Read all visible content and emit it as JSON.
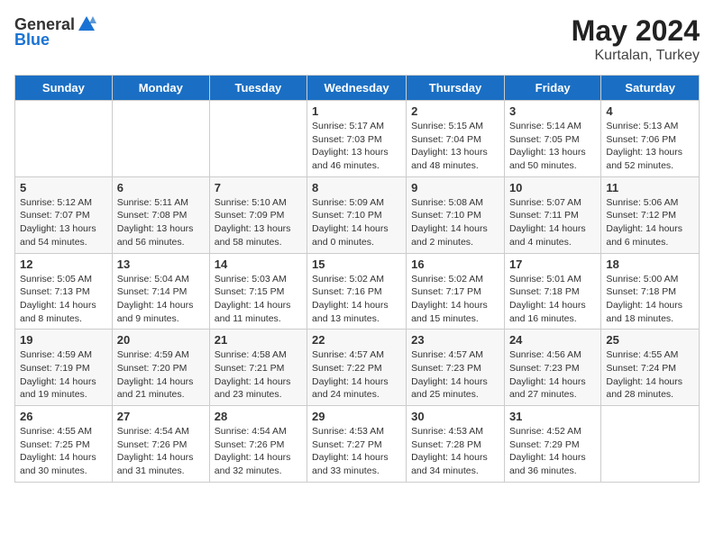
{
  "header": {
    "logo_general": "General",
    "logo_blue": "Blue",
    "month_year": "May 2024",
    "location": "Kurtalan, Turkey"
  },
  "days_of_week": [
    "Sunday",
    "Monday",
    "Tuesday",
    "Wednesday",
    "Thursday",
    "Friday",
    "Saturday"
  ],
  "weeks": [
    [
      {
        "day": "",
        "info": ""
      },
      {
        "day": "",
        "info": ""
      },
      {
        "day": "",
        "info": ""
      },
      {
        "day": "1",
        "info": "Sunrise: 5:17 AM\nSunset: 7:03 PM\nDaylight: 13 hours\nand 46 minutes."
      },
      {
        "day": "2",
        "info": "Sunrise: 5:15 AM\nSunset: 7:04 PM\nDaylight: 13 hours\nand 48 minutes."
      },
      {
        "day": "3",
        "info": "Sunrise: 5:14 AM\nSunset: 7:05 PM\nDaylight: 13 hours\nand 50 minutes."
      },
      {
        "day": "4",
        "info": "Sunrise: 5:13 AM\nSunset: 7:06 PM\nDaylight: 13 hours\nand 52 minutes."
      }
    ],
    [
      {
        "day": "5",
        "info": "Sunrise: 5:12 AM\nSunset: 7:07 PM\nDaylight: 13 hours\nand 54 minutes."
      },
      {
        "day": "6",
        "info": "Sunrise: 5:11 AM\nSunset: 7:08 PM\nDaylight: 13 hours\nand 56 minutes."
      },
      {
        "day": "7",
        "info": "Sunrise: 5:10 AM\nSunset: 7:09 PM\nDaylight: 13 hours\nand 58 minutes."
      },
      {
        "day": "8",
        "info": "Sunrise: 5:09 AM\nSunset: 7:10 PM\nDaylight: 14 hours\nand 0 minutes."
      },
      {
        "day": "9",
        "info": "Sunrise: 5:08 AM\nSunset: 7:10 PM\nDaylight: 14 hours\nand 2 minutes."
      },
      {
        "day": "10",
        "info": "Sunrise: 5:07 AM\nSunset: 7:11 PM\nDaylight: 14 hours\nand 4 minutes."
      },
      {
        "day": "11",
        "info": "Sunrise: 5:06 AM\nSunset: 7:12 PM\nDaylight: 14 hours\nand 6 minutes."
      }
    ],
    [
      {
        "day": "12",
        "info": "Sunrise: 5:05 AM\nSunset: 7:13 PM\nDaylight: 14 hours\nand 8 minutes."
      },
      {
        "day": "13",
        "info": "Sunrise: 5:04 AM\nSunset: 7:14 PM\nDaylight: 14 hours\nand 9 minutes."
      },
      {
        "day": "14",
        "info": "Sunrise: 5:03 AM\nSunset: 7:15 PM\nDaylight: 14 hours\nand 11 minutes."
      },
      {
        "day": "15",
        "info": "Sunrise: 5:02 AM\nSunset: 7:16 PM\nDaylight: 14 hours\nand 13 minutes."
      },
      {
        "day": "16",
        "info": "Sunrise: 5:02 AM\nSunset: 7:17 PM\nDaylight: 14 hours\nand 15 minutes."
      },
      {
        "day": "17",
        "info": "Sunrise: 5:01 AM\nSunset: 7:18 PM\nDaylight: 14 hours\nand 16 minutes."
      },
      {
        "day": "18",
        "info": "Sunrise: 5:00 AM\nSunset: 7:18 PM\nDaylight: 14 hours\nand 18 minutes."
      }
    ],
    [
      {
        "day": "19",
        "info": "Sunrise: 4:59 AM\nSunset: 7:19 PM\nDaylight: 14 hours\nand 19 minutes."
      },
      {
        "day": "20",
        "info": "Sunrise: 4:59 AM\nSunset: 7:20 PM\nDaylight: 14 hours\nand 21 minutes."
      },
      {
        "day": "21",
        "info": "Sunrise: 4:58 AM\nSunset: 7:21 PM\nDaylight: 14 hours\nand 23 minutes."
      },
      {
        "day": "22",
        "info": "Sunrise: 4:57 AM\nSunset: 7:22 PM\nDaylight: 14 hours\nand 24 minutes."
      },
      {
        "day": "23",
        "info": "Sunrise: 4:57 AM\nSunset: 7:23 PM\nDaylight: 14 hours\nand 25 minutes."
      },
      {
        "day": "24",
        "info": "Sunrise: 4:56 AM\nSunset: 7:23 PM\nDaylight: 14 hours\nand 27 minutes."
      },
      {
        "day": "25",
        "info": "Sunrise: 4:55 AM\nSunset: 7:24 PM\nDaylight: 14 hours\nand 28 minutes."
      }
    ],
    [
      {
        "day": "26",
        "info": "Sunrise: 4:55 AM\nSunset: 7:25 PM\nDaylight: 14 hours\nand 30 minutes."
      },
      {
        "day": "27",
        "info": "Sunrise: 4:54 AM\nSunset: 7:26 PM\nDaylight: 14 hours\nand 31 minutes."
      },
      {
        "day": "28",
        "info": "Sunrise: 4:54 AM\nSunset: 7:26 PM\nDaylight: 14 hours\nand 32 minutes."
      },
      {
        "day": "29",
        "info": "Sunrise: 4:53 AM\nSunset: 7:27 PM\nDaylight: 14 hours\nand 33 minutes."
      },
      {
        "day": "30",
        "info": "Sunrise: 4:53 AM\nSunset: 7:28 PM\nDaylight: 14 hours\nand 34 minutes."
      },
      {
        "day": "31",
        "info": "Sunrise: 4:52 AM\nSunset: 7:29 PM\nDaylight: 14 hours\nand 36 minutes."
      },
      {
        "day": "",
        "info": ""
      }
    ]
  ]
}
